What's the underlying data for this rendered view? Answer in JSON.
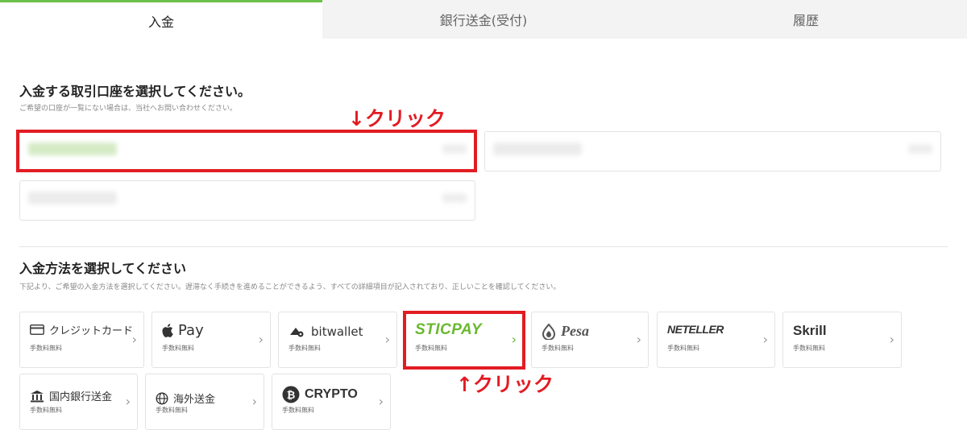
{
  "tabs": [
    {
      "label": "入金",
      "active": true
    },
    {
      "label": "銀行送金(受付)",
      "active": false
    },
    {
      "label": "履歴",
      "active": false
    }
  ],
  "account_section": {
    "title": "入金する取引口座を選択してください。",
    "subtitle": "ご希望の口座が一覧にない場合は、当社へお問い合わせください。"
  },
  "method_section": {
    "title": "入金方法を選択してください",
    "subtitle": "下記より、ご希望の入金方法を選択してください。遅滞なく手続きを進めることができるよう、すべての詳細項目が記入されており、正しいことを確認してください。"
  },
  "annotations": {
    "top": "↓クリック",
    "bottom": "↑クリック"
  },
  "methods": [
    {
      "label": "クレジットカード",
      "fee": "手数料無料",
      "icon": "credit-card-icon"
    },
    {
      "label": "Pay",
      "fee": "手数料無料",
      "icon": "apple-icon"
    },
    {
      "label": "bitwallet",
      "fee": "手数料無料",
      "icon": "bitwallet-icon"
    },
    {
      "label": "STICPAY",
      "fee": "手数料無料",
      "icon": "sticpay-logo"
    },
    {
      "label": "Pesa",
      "fee": "手数料無料",
      "icon": "pesa-icon"
    },
    {
      "label": "NETELLER",
      "fee": "手数料無料",
      "icon": "neteller-logo"
    },
    {
      "label": "Skrill",
      "fee": "手数料無料",
      "icon": "skrill-logo"
    },
    {
      "label": "国内銀行送金",
      "fee": "手数料無料",
      "icon": "bank-icon"
    },
    {
      "label": "海外送金",
      "fee": "手数料無料",
      "icon": "globe-icon"
    },
    {
      "label": "CRYPTO",
      "fee": "手数料無料",
      "icon": "bitcoin-icon"
    }
  ],
  "colors": {
    "accent_green": "#6cbf4a",
    "highlight_red": "#e21c23",
    "sticpay_green": "#6ab82f"
  }
}
